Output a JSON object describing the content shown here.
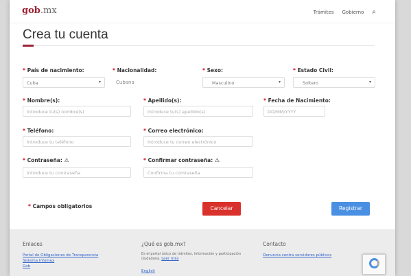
{
  "header": {
    "logo_main": "gob",
    "logo_suffix": ".mx",
    "nav": [
      "Trámites",
      "Gobierno"
    ],
    "search_icon": "search-icon"
  },
  "page": {
    "title": "Crea tu cuenta"
  },
  "form": {
    "required_mark": "*",
    "birth_country": {
      "label": "País de nacimiento:",
      "value": "Cuba"
    },
    "nationality": {
      "label": "Nacionalidad:",
      "value": "Cubana"
    },
    "sex": {
      "label": "Sexo:",
      "value": "Masculino"
    },
    "civil_status": {
      "label": "Estado Civil:",
      "value": "Soltero"
    },
    "first_name": {
      "label": "Nombre(s):",
      "placeholder": "Introduce tu(s) nombre(s)"
    },
    "last_name": {
      "label": "Apellido(s):",
      "placeholder": "Introduce tu(s) apellido(s)"
    },
    "birth_date": {
      "label": "Fecha de Nacimiento:",
      "placeholder": "DD/MM/YYYY"
    },
    "phone": {
      "label": "Teléfono:",
      "placeholder": "Introduce tu teléfono"
    },
    "email": {
      "label": "Correo electrónico:",
      "placeholder": "Introduce tu correo electrónico"
    },
    "password": {
      "label": "Contraseña:",
      "placeholder": "Introduce tu contraseña"
    },
    "confirm_password": {
      "label": "Confirmar contraseña:",
      "placeholder": "Confirma tu contraseña"
    },
    "required_note": "Campos obligatorios",
    "cancel_label": "Cancelar",
    "register_label": "Registrar",
    "warning_glyph": "⚠",
    "caret_glyph": "▾"
  },
  "footer": {
    "links_title": "Enlaces",
    "links": [
      "Portal de Obligaciones de Transparencia",
      "Sistema Infomex",
      "Gob"
    ],
    "about_title": "¿Qué es gob.mx?",
    "about_text": "Es el portal único de trámites, información y participación ciudadana.",
    "about_more": "Leer más",
    "about_lang": "English",
    "contact_title": "Contacto",
    "contact_link": "Denuncia contra servidores públicos"
  },
  "colors": {
    "brand": "#9d2235",
    "cancel": "#d9312b",
    "register": "#4a90e2",
    "required": "#d0021b"
  }
}
